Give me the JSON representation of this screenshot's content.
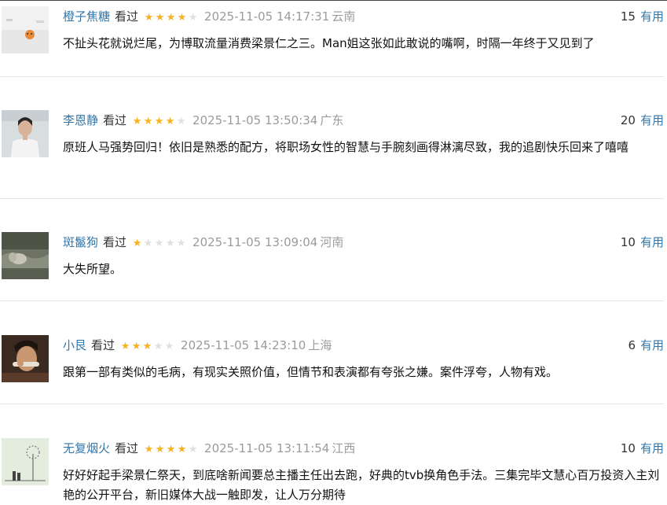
{
  "colors": {
    "link": "#3377aa",
    "star_on": "#f7b21f",
    "star_off": "#e0e0e0",
    "meta_gray": "#9b9b9b"
  },
  "reviews": [
    {
      "author": "橙子焦糖",
      "status": "看过",
      "rating": 4,
      "time": "2025-11-05 14:17:31",
      "location": "云南",
      "useful_count": "15",
      "useful_label": "有用",
      "content": "不扯头花就说烂尾，为博取流量消费梁景仁之三。Man姐这张如此敢说的嘴啊，时隔一年终于又见到了"
    },
    {
      "author": "李恩静",
      "status": "看过",
      "rating": 4,
      "time": "2025-11-05 13:50:34",
      "location": "广东",
      "useful_count": "20",
      "useful_label": "有用",
      "content": "原班人马强势回归！依旧是熟悉的配方，将职场女性的智慧与手腕刻画得淋漓尽致，我的追剧快乐回来了嘻嘻"
    },
    {
      "author": "斑鬣狗",
      "status": "看过",
      "rating": 1,
      "time": "2025-11-05 13:09:04",
      "location": "河南",
      "useful_count": "10",
      "useful_label": "有用",
      "content": "大失所望。"
    },
    {
      "author": "小艮",
      "status": "看过",
      "rating": 3,
      "time": "2025-11-05 14:23:10",
      "location": "上海",
      "useful_count": "6",
      "useful_label": "有用",
      "content": "跟第一部有类似的毛病，有现实关照价值，但情节和表演都有夸张之嫌。案件浮夸，人物有戏。"
    },
    {
      "author": "无复烟火",
      "status": "看过",
      "rating": 4,
      "time": "2025-11-05 13:11:54",
      "location": "江西",
      "useful_count": "10",
      "useful_label": "有用",
      "content": "好好好起手梁景仁祭天，到底啥新闻要总主播主任出去跑，好典的tvb换角色手法。三集完毕文慧心百万投资入主刘艳的公开平台，新旧媒体大战一触即发，让人万分期待"
    }
  ]
}
